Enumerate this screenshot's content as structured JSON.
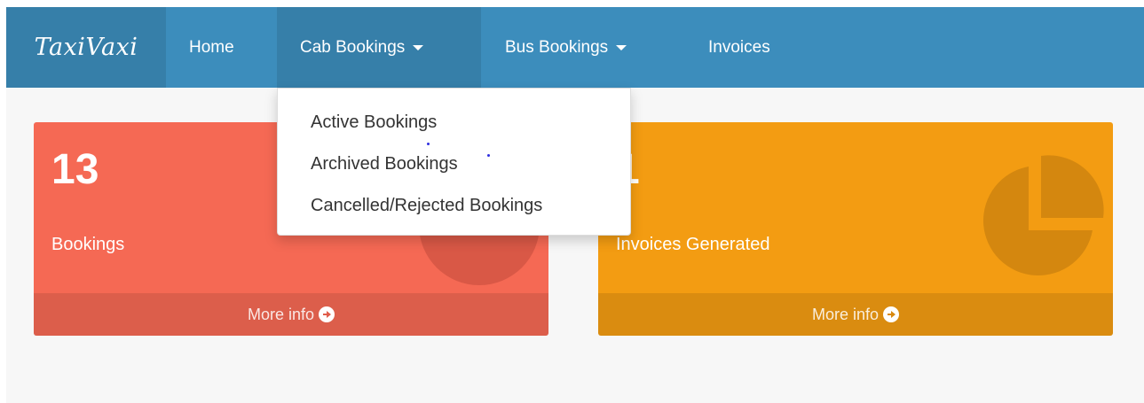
{
  "navbar": {
    "brand": "TaxiVaxi",
    "items": [
      {
        "label": "Home"
      },
      {
        "label": "Cab Bookings",
        "dropdown": true,
        "active": true
      },
      {
        "label": "Bus Bookings",
        "dropdown": true
      },
      {
        "label": "Invoices"
      }
    ]
  },
  "dropdown": {
    "items": [
      "Active Bookings",
      "Archived Bookings",
      "Cancelled/Rejected Bookings"
    ]
  },
  "boxes": [
    {
      "number": "13",
      "label": "Bookings",
      "more": "More info",
      "color": "#f56954",
      "icon": "chart-circle-icon"
    },
    {
      "number": "1",
      "label": "Invoices Generated",
      "more": "More info",
      "color": "#f39c12",
      "icon": "pie-chart-icon"
    }
  ],
  "colors": {
    "navbar": "#3c8dbc",
    "navbar_active": "#367fa9",
    "background": "#f7f7f7"
  }
}
